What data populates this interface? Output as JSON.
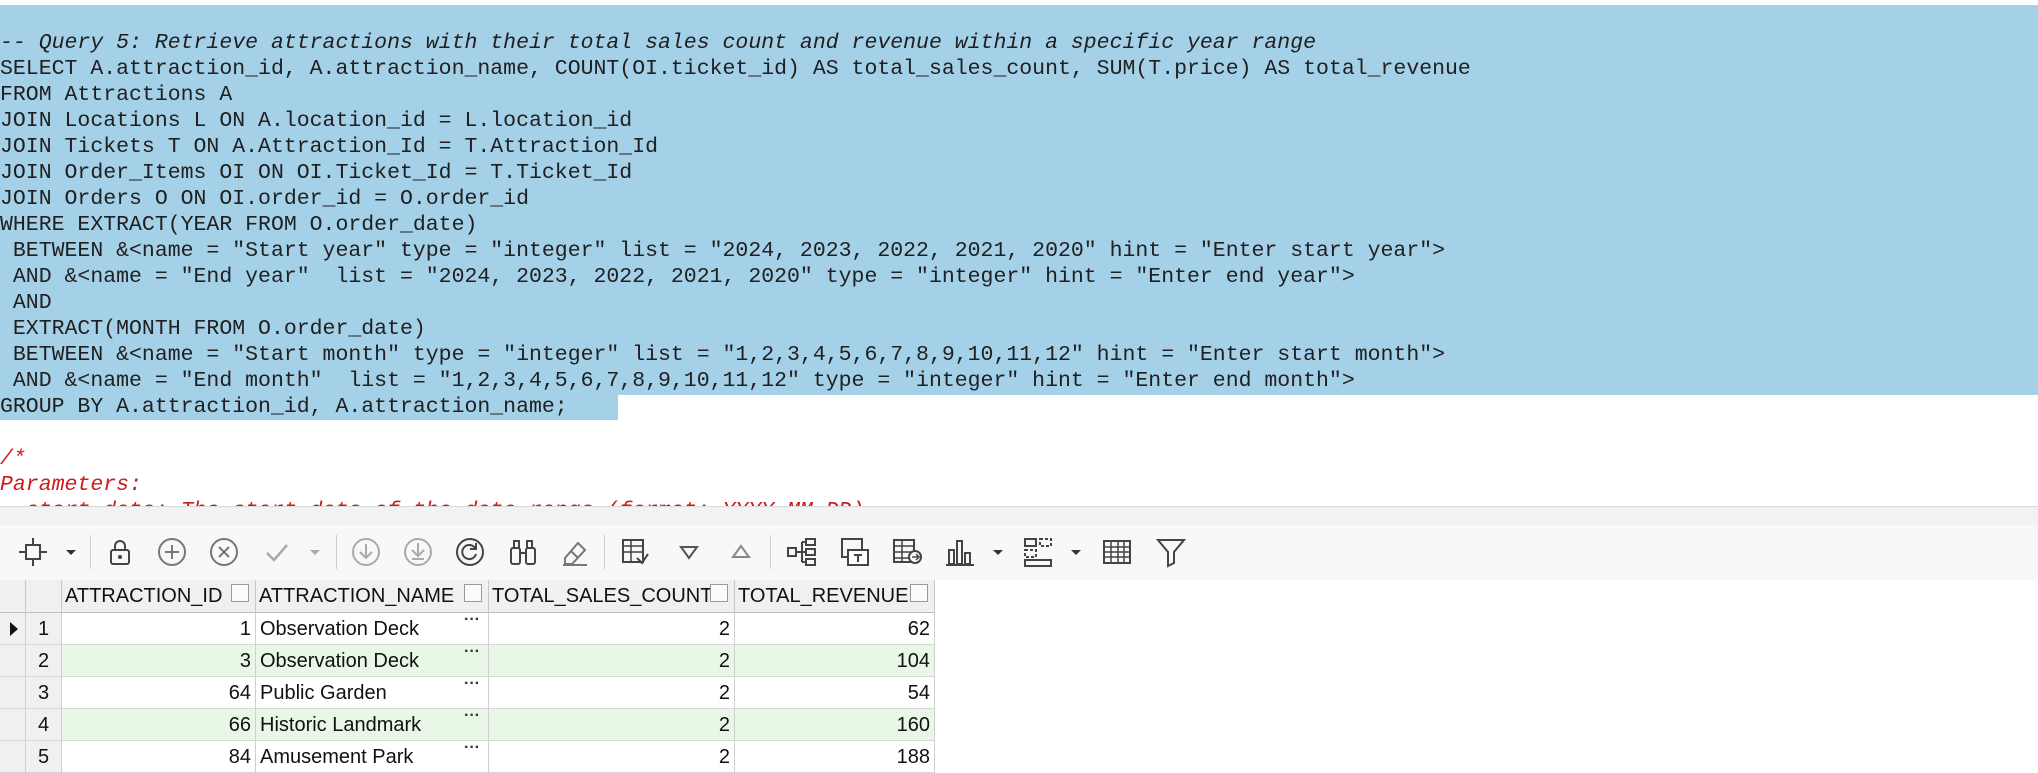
{
  "editor": {
    "lines": [
      "-- Query 5: Retrieve attractions with their total sales count and revenue within a specific year range",
      "SELECT A.attraction_id, A.attraction_name, COUNT(OI.ticket_id) AS total_sales_count, SUM(T.price) AS total_revenue",
      "FROM Attractions A",
      "JOIN Locations L ON A.location_id = L.location_id",
      "JOIN Tickets T ON A.Attraction_Id = T.Attraction_Id",
      "JOIN Order_Items OI ON OI.Ticket_Id = T.Ticket_Id",
      "JOIN Orders O ON OI.order_id = O.order_id",
      "WHERE EXTRACT(YEAR FROM O.order_date)",
      " BETWEEN &<name = \"Start year\" type = \"integer\" list = \"2024, 2023, 2022, 2021, 2020\" hint = \"Enter start year\">",
      " AND &<name = \"End year\"  list = \"2024, 2023, 2022, 2021, 2020\" type = \"integer\" hint = \"Enter end year\">",
      " AND",
      " EXTRACT(MONTH FROM O.order_date)",
      " BETWEEN &<name = \"Start month\" type = \"integer\" list = \"1,2,3,4,5,6,7,8,9,10,11,12\" hint = \"Enter start month\">",
      " AND &<name = \"End month\"  list = \"1,2,3,4,5,6,7,8,9,10,11,12\" type = \"integer\" hint = \"Enter end month\">",
      "GROUP BY A.attraction_id, A.attraction_name;",
      "",
      "/*",
      "Parameters:",
      "- start_date: The start date of the date range (format: YYYY-MM-DD)"
    ]
  },
  "toolbar": {
    "icons": [
      "record-navigation-icon",
      "lock-icon",
      "add-record-icon",
      "delete-record-icon",
      "post-edit-icon",
      "fetch-next-icon",
      "fetch-last-icon",
      "refresh-icon",
      "query-by-example-icon",
      "clear-icon",
      "single-record-view-icon",
      "filter-down-icon",
      "filter-up-icon",
      "tree-view-icon",
      "export-icon",
      "import-icon",
      "chart-icon",
      "pivot-icon",
      "grid-icon",
      "funnel-filter-icon"
    ]
  },
  "grid": {
    "columns": [
      "ATTRACTION_ID",
      "ATTRACTION_NAME",
      "TOTAL_SALES_COUNT",
      "TOTAL_REVENUE"
    ],
    "rows": [
      {
        "n": "1",
        "id": "1",
        "name": "Observation Deck",
        "count": "2",
        "revenue": "62"
      },
      {
        "n": "2",
        "id": "3",
        "name": "Observation Deck",
        "count": "2",
        "revenue": "104"
      },
      {
        "n": "3",
        "id": "64",
        "name": "Public Garden",
        "count": "2",
        "revenue": "54"
      },
      {
        "n": "4",
        "id": "66",
        "name": "Historic Landmark",
        "count": "2",
        "revenue": "160"
      },
      {
        "n": "5",
        "id": "84",
        "name": "Amusement Park",
        "count": "2",
        "revenue": "188"
      }
    ]
  },
  "colors": {
    "selection": "#a5d1e8",
    "comment": "#cc1b1b",
    "alt_row": "#e9f8e6"
  }
}
